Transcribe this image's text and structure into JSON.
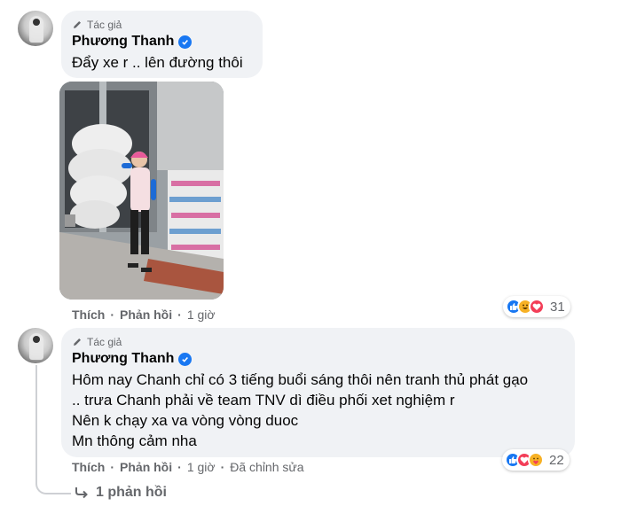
{
  "comments": [
    {
      "author_tag": "Tác giả",
      "name": "Phương Thanh",
      "text": [
        "Đẩy xe r .. lên đường thôi"
      ],
      "actions": {
        "like": "Thích",
        "reply": "Phản hồi",
        "time": "1 giờ"
      },
      "reactions": {
        "count": "31",
        "icons": [
          "like-icon",
          "haha-icon",
          "love-icon"
        ]
      }
    },
    {
      "author_tag": "Tác giả",
      "name": "Phương Thanh",
      "text": [
        "Hôm nay Chanh chỉ có 3 tiếng buổi sáng thôi nên tranh thủ phát gạo",
        ".. trưa Chanh phải về team TNV dì điều phối xet nghiệm r",
        "Nên k chạy xa va vòng vòng duoc",
        "Mn thông cảm nha"
      ],
      "actions": {
        "like": "Thích",
        "reply": "Phản hồi",
        "time": "1 giờ",
        "edited": "Đã chỉnh sửa"
      },
      "reactions": {
        "count": "22",
        "icons": [
          "like-icon",
          "love-icon",
          "care-icon"
        ]
      }
    }
  ],
  "replies_link": "1 phản hồi",
  "colors": {
    "like": "#1877f2",
    "love": "#f33e58",
    "haha": "#f7b125",
    "bubble": "#f0f2f5"
  }
}
